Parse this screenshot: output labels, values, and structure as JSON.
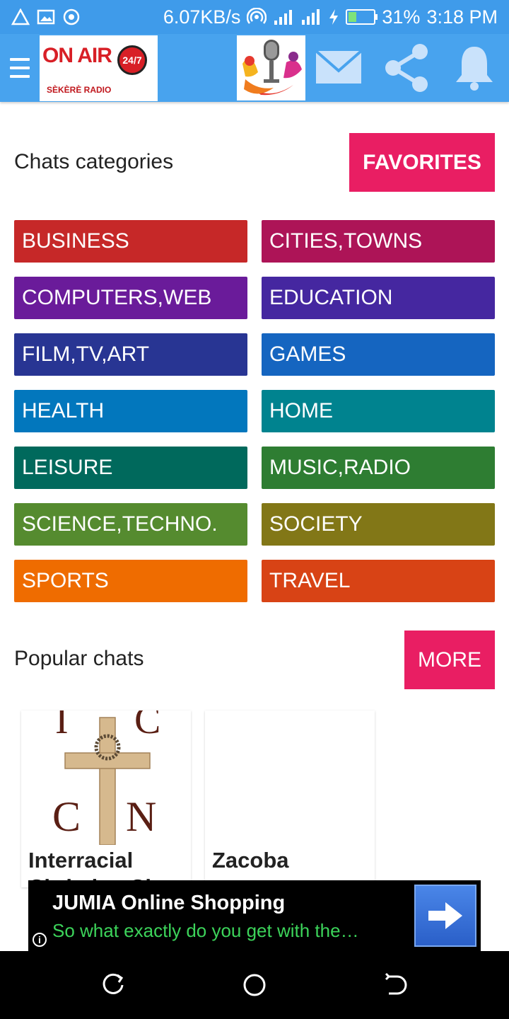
{
  "status_bar": {
    "net_speed": "6.07KB/s",
    "battery_percent": "31%",
    "battery_level": 0.31,
    "time": "3:18 PM"
  },
  "app_bar": {
    "logo_text": "ON AIR",
    "logo_badge": "24/7",
    "logo_sub": "SÈKÈRÈ RADIO",
    "icons": [
      "menu-icon",
      "mail-icon",
      "share-icon",
      "bell-icon"
    ]
  },
  "categories": {
    "title": "Chats categories",
    "favorites_label": "FAVORITES",
    "items": [
      {
        "label": "BUSINESS",
        "color": "#c62828"
      },
      {
        "label": "CITIES,TOWNS",
        "color": "#ad1457"
      },
      {
        "label": "COMPUTERS,WEB",
        "color": "#6a1b9a"
      },
      {
        "label": "EDUCATION",
        "color": "#4527a0"
      },
      {
        "label": "FILM,TV,ART",
        "color": "#283593"
      },
      {
        "label": "GAMES",
        "color": "#1565c0"
      },
      {
        "label": "HEALTH",
        "color": "#0277bd"
      },
      {
        "label": "HOME",
        "color": "#00838f"
      },
      {
        "label": "LEISURE",
        "color": "#00695c"
      },
      {
        "label": "MUSIC,RADIO",
        "color": "#2e7d32"
      },
      {
        "label": "SCIENCE,TECHNO.",
        "color": "#558b2f"
      },
      {
        "label": "SOCIETY",
        "color": "#827717"
      },
      {
        "label": "SPORTS",
        "color": "#ef6c00"
      },
      {
        "label": "TRAVEL",
        "color": "#d84315"
      }
    ]
  },
  "popular": {
    "title": "Popular chats",
    "more_label": "MORE",
    "cards": [
      {
        "title": "Interracial",
        "title_line2": "Christian Ch"
      },
      {
        "title": "Zacoba"
      }
    ]
  },
  "ad": {
    "title": "JUMIA Online Shopping",
    "text": "So what exactly do you get with the…",
    "info_icon": "i"
  },
  "colors": {
    "app_bar": "#48a3ee",
    "status_bar": "#3f9bea",
    "accent": "#e91e63"
  }
}
